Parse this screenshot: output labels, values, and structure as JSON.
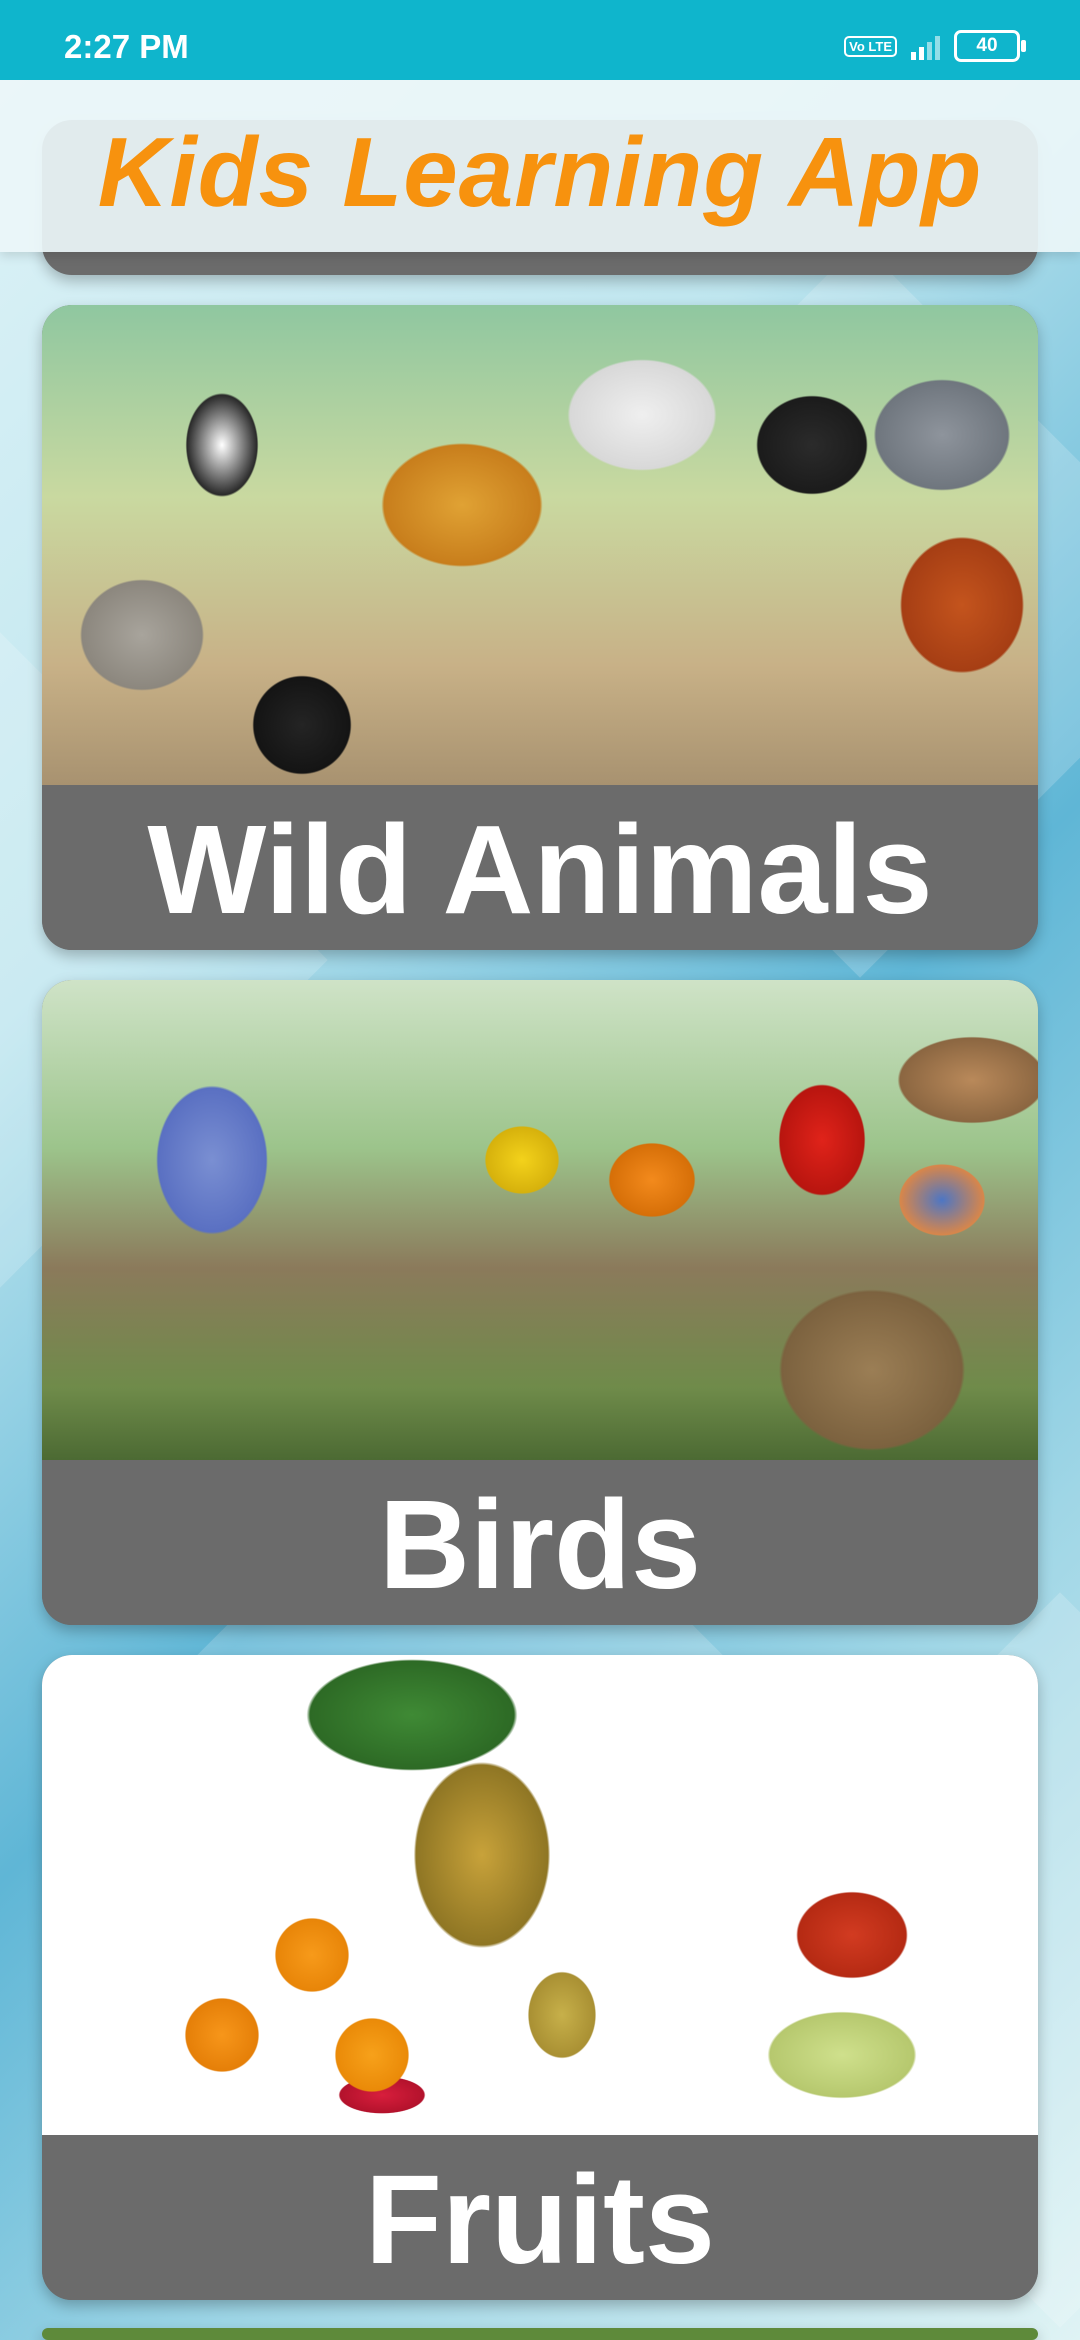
{
  "status_bar": {
    "time": "2:27 PM",
    "volte": "Vo LTE",
    "battery": "40"
  },
  "app_bar": {
    "title": "Kids Learning App"
  },
  "categories": [
    {
      "label": "Wild Animals",
      "image": "wild-animals-illustration"
    },
    {
      "label": "Birds",
      "image": "birds-illustration"
    },
    {
      "label": "Fruits",
      "image": "fruits-illustration"
    }
  ],
  "colors": {
    "status_bar": "#0fb5cc",
    "title": "#f7920e",
    "label_band": "#6b6b6b"
  }
}
